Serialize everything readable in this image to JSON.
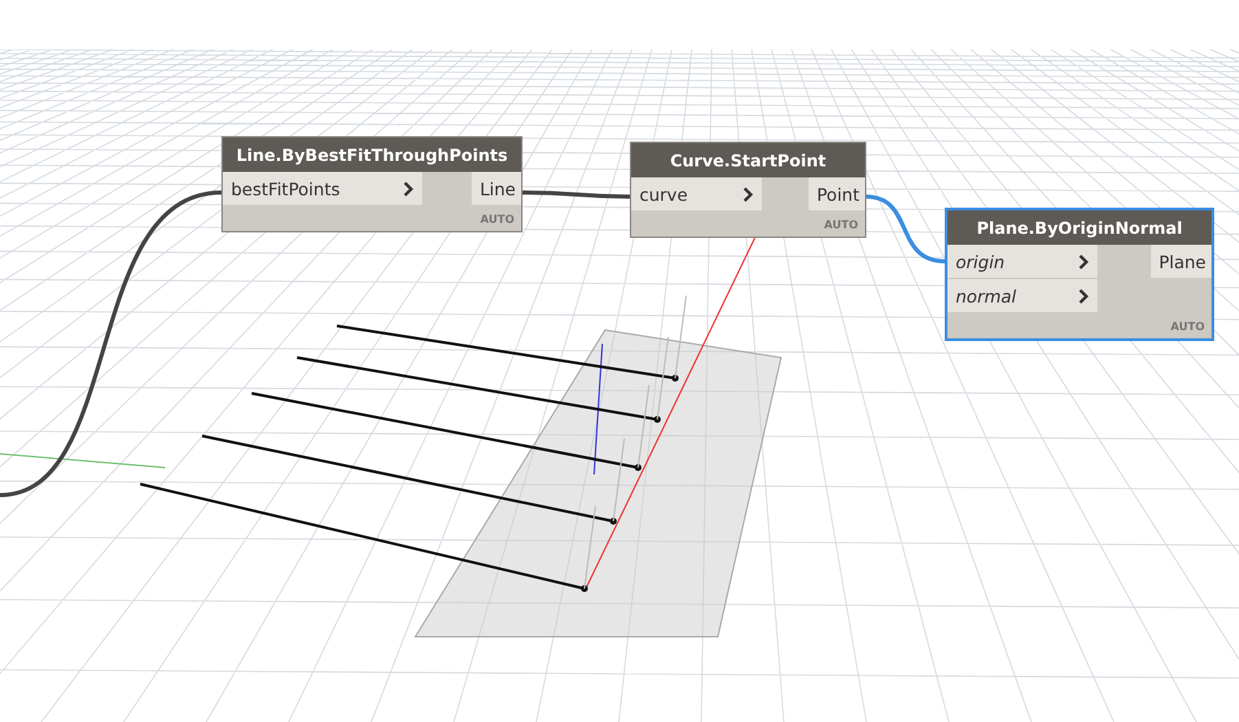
{
  "nodes": [
    {
      "title": "Line.ByBestFitThroughPoints",
      "selected": false,
      "inputs": [
        {
          "name": "bestFitPoints",
          "italic": false
        }
      ],
      "outputs": [
        "Line"
      ],
      "lacing": "AUTO"
    },
    {
      "title": "Curve.StartPoint",
      "selected": false,
      "inputs": [
        {
          "name": "curve",
          "italic": false
        }
      ],
      "outputs": [
        "Point"
      ],
      "lacing": "AUTO"
    },
    {
      "title": "Plane.ByOriginNormal",
      "selected": true,
      "inputs": [
        {
          "name": "origin",
          "italic": true
        },
        {
          "name": "normal",
          "italic": true
        }
      ],
      "outputs": [
        "Plane"
      ],
      "lacing": "AUTO"
    }
  ]
}
